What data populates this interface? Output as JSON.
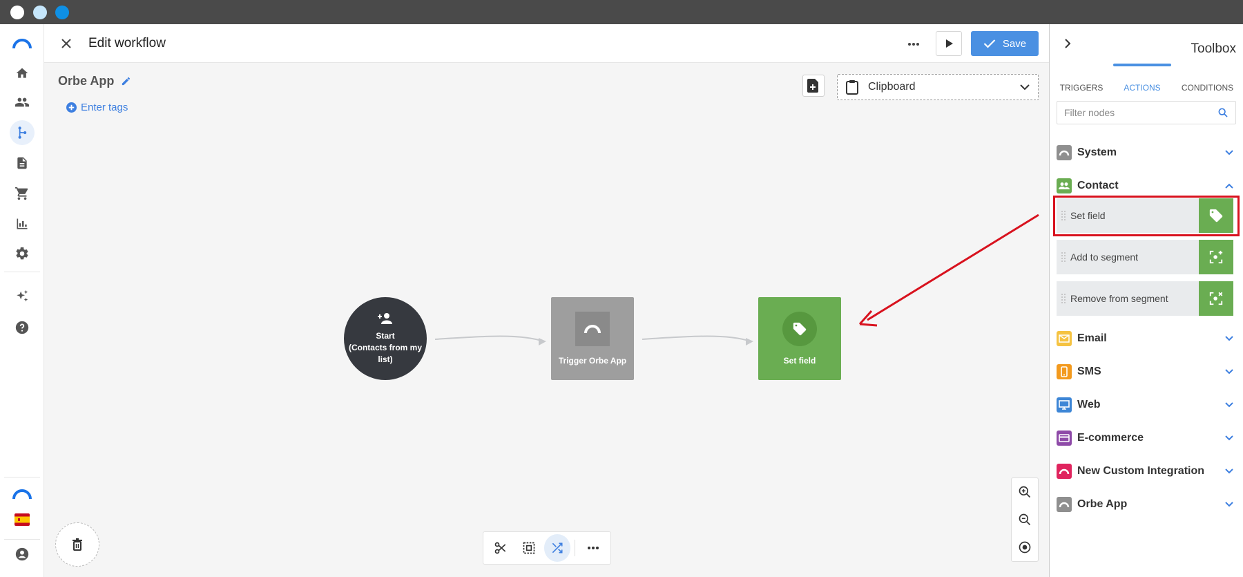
{
  "window": {
    "dot_colors": [
      "#ffffff",
      "#c5e6fb",
      "#0f90e5"
    ]
  },
  "leftnav": {
    "items": [
      {
        "name": "logo-icon"
      },
      {
        "name": "home-icon"
      },
      {
        "name": "contacts-icon"
      },
      {
        "name": "workflows-icon",
        "active": true
      },
      {
        "name": "document-icon"
      },
      {
        "name": "cart-icon"
      },
      {
        "name": "bar-chart-icon"
      },
      {
        "name": "settings-icon"
      },
      {
        "name": "sparkles-icon"
      },
      {
        "name": "help-icon"
      },
      {
        "name": "brand-logo-icon"
      },
      {
        "name": "spain-flag-icon"
      },
      {
        "name": "user-account-icon"
      }
    ]
  },
  "header": {
    "title": "Edit workflow",
    "save_label": "Save"
  },
  "canvas": {
    "workflow_name": "Orbe App",
    "enter_tags": "Enter tags",
    "clipboard_label": "Clipboard",
    "nodes": {
      "start": {
        "line1": "Start",
        "line2": "(Contacts from my",
        "line3": "list)"
      },
      "trigger": {
        "label": "Trigger Orbe App"
      },
      "setfield": {
        "label": "Set field"
      }
    }
  },
  "toolbox": {
    "title": "Toolbox",
    "tabs": [
      "TRIGGERS",
      "ACTIONS",
      "CONDITIONS"
    ],
    "active_tab": "ACTIONS",
    "filter_placeholder": "Filter nodes",
    "categories": [
      {
        "label": "System",
        "color": "#8f8f8f",
        "icon": "orbe-icon",
        "expanded": false
      },
      {
        "label": "Contact",
        "color": "#6aad52",
        "icon": "contacts-icon",
        "expanded": true
      },
      {
        "label": "Email",
        "color": "#f5c342",
        "icon": "mail-icon",
        "expanded": false
      },
      {
        "label": "SMS",
        "color": "#f39a1e",
        "icon": "phone-icon",
        "expanded": false
      },
      {
        "label": "Web",
        "color": "#3d86d6",
        "icon": "monitor-icon",
        "expanded": false
      },
      {
        "label": "E-commerce",
        "color": "#8e4aa8",
        "icon": "card-icon",
        "expanded": false
      },
      {
        "label": "New Custom Integration",
        "color": "#e0245e",
        "icon": "orbe-icon",
        "expanded": false
      },
      {
        "label": "Orbe App",
        "color": "#8f8f8f",
        "icon": "orbe-icon",
        "expanded": false
      }
    ],
    "contact_actions": [
      {
        "label": "Set field",
        "icon": "tag-icon",
        "highlighted": true
      },
      {
        "label": "Add to segment",
        "icon": "segment-add-icon"
      },
      {
        "label": "Remove from segment",
        "icon": "segment-remove-icon"
      }
    ]
  },
  "colors": {
    "accent": "#4a90e2",
    "green": "#6aad52",
    "annotation_red": "#d8121e"
  }
}
